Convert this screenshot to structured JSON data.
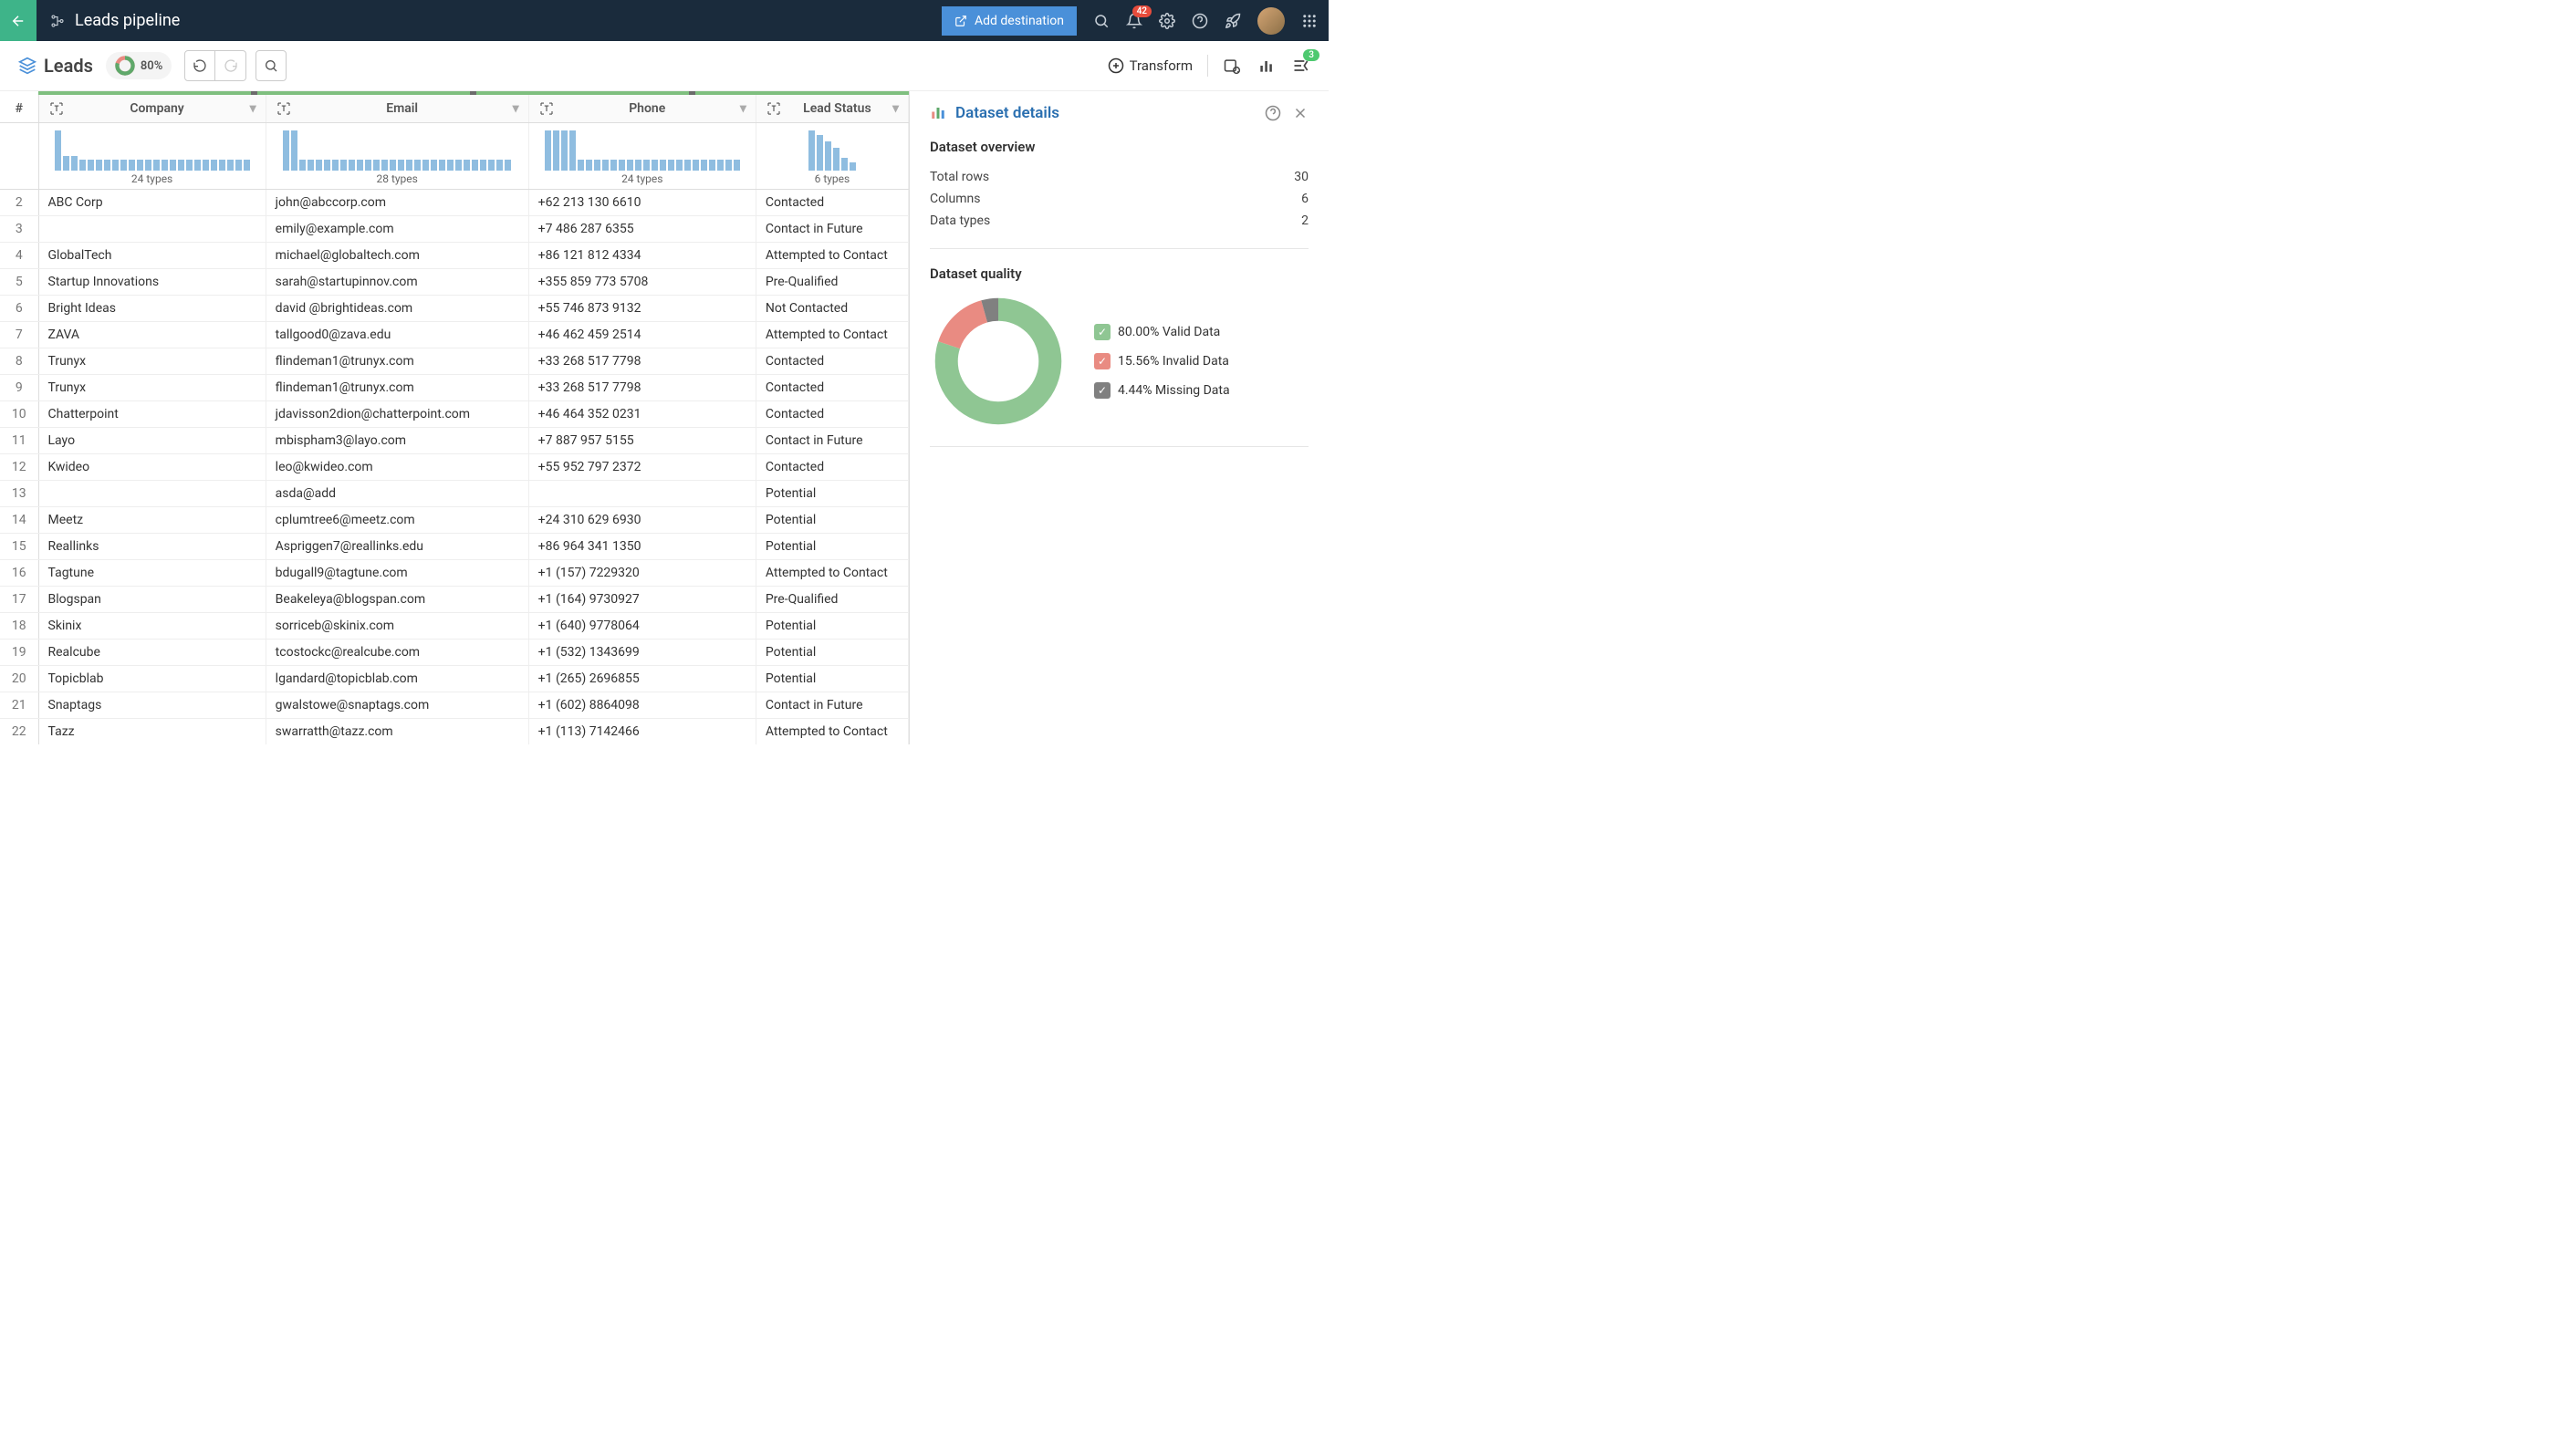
{
  "header": {
    "title": "Leads pipeline",
    "add_destination": "Add destination",
    "notifications_count": "42"
  },
  "toolbar": {
    "leads_label": "Leads",
    "quality_pct": "80%",
    "transform": "Transform",
    "steps_count": "3"
  },
  "columns": [
    {
      "name": "Company",
      "types": "24 types",
      "hist": [
        50,
        18,
        18,
        14,
        14,
        14,
        14,
        14,
        14,
        14,
        14,
        14,
        14,
        14,
        14,
        14,
        14,
        14,
        14,
        14,
        14,
        14,
        14,
        14
      ]
    },
    {
      "name": "Email",
      "types": "28 types",
      "hist": [
        50,
        50,
        14,
        14,
        14,
        14,
        14,
        14,
        14,
        14,
        14,
        14,
        14,
        14,
        14,
        14,
        14,
        14,
        14,
        14,
        14,
        14,
        14,
        14,
        14,
        14,
        14,
        14
      ]
    },
    {
      "name": "Phone",
      "types": "24 types",
      "hist": [
        50,
        50,
        50,
        50,
        14,
        14,
        14,
        14,
        14,
        14,
        14,
        14,
        14,
        14,
        14,
        14,
        14,
        14,
        14,
        14,
        14,
        14,
        14,
        14
      ]
    },
    {
      "name": "Lead Status",
      "types": "6 types",
      "hist": [
        50,
        44,
        36,
        28,
        16,
        10
      ]
    }
  ],
  "rows": [
    {
      "n": 2,
      "company": "ABC Corp",
      "email": "john@abccorp.com",
      "phone": "+62 213 130 6610",
      "status": "Contacted"
    },
    {
      "n": 3,
      "company": "",
      "email": "emily@example.com",
      "phone": "+7 486 287 6355",
      "status": "Contact in Future"
    },
    {
      "n": 4,
      "company": "GlobalTech",
      "email": "michael@globaltech.com",
      "phone": "+86 121 812 4334",
      "status": "Attempted to Contact"
    },
    {
      "n": 5,
      "company": "Startup Innovations",
      "email": "sarah@startupinnov.com",
      "phone": "+355 859 773 5708",
      "status": "Pre-Qualified"
    },
    {
      "n": 6,
      "company": "Bright Ideas",
      "email": "david  @brightideas.com",
      "phone": "+55 746 873 9132",
      "status": "Not Contacted"
    },
    {
      "n": 7,
      "company": "ZAVA",
      "email": "tallgood0@zava.edu",
      "phone": "+46 462 459 2514",
      "status": "Attempted to Contact"
    },
    {
      "n": 8,
      "company": "Trunyx",
      "email": "flindeman1@trunyx.com",
      "phone": "+33 268 517 7798",
      "status": "Contacted"
    },
    {
      "n": 9,
      "company": "Trunyx",
      "email": "flindeman1@trunyx.com",
      "phone": "+33 268 517 7798",
      "status": "Contacted"
    },
    {
      "n": 10,
      "company": "Chatterpoint",
      "email": "jdavisson2dion@chatterpoint.com",
      "phone": "+46 464 352 0231",
      "status": "Contacted"
    },
    {
      "n": 11,
      "company": "Layo",
      "email": "mbispham3@layo.com",
      "phone": "+7 887 957 5155",
      "status": "Contact in Future"
    },
    {
      "n": 12,
      "company": "Kwideo",
      "email": "leo@kwideo.com",
      "phone": "+55 952 797 2372",
      "status": "Contacted"
    },
    {
      "n": 13,
      "company": "",
      "email": "asda@add",
      "phone": "",
      "status": "Potential"
    },
    {
      "n": 14,
      "company": "Meetz",
      "email": "cplumtree6@meetz.com",
      "phone": "+24 310 629 6930",
      "status": "Potential"
    },
    {
      "n": 15,
      "company": "Reallinks",
      "email": "Aspriggen7@reallinks.edu",
      "phone": "+86 964 341 1350",
      "status": "Potential"
    },
    {
      "n": 16,
      "company": "Tagtune",
      "email": "bdugall9@tagtune.com",
      "phone": "+1 (157) 7229320",
      "status": "Attempted to Contact"
    },
    {
      "n": 17,
      "company": "Blogspan",
      "email": "Beakeleya@blogspan.com",
      "phone": "+1 (164) 9730927",
      "status": "Pre-Qualified"
    },
    {
      "n": 18,
      "company": "Skinix",
      "email": "sorriceb@skinix.com",
      "phone": "+1 (640) 9778064",
      "status": "Potential"
    },
    {
      "n": 19,
      "company": "Realcube",
      "email": "tcostockc@realcube.com",
      "phone": "+1 (532) 1343699",
      "status": "Potential"
    },
    {
      "n": 20,
      "company": "Topicblab",
      "email": "lgandard@topicblab.com",
      "phone": "+1 (265) 2696855",
      "status": "Potential"
    },
    {
      "n": 21,
      "company": "Snaptags",
      "email": "gwalstowe@snaptags.com",
      "phone": "+1 (602) 8864098",
      "status": "Contact in Future"
    },
    {
      "n": 22,
      "company": "Tazz",
      "email": "swarratth@tazz.com",
      "phone": "+1 (113) 7142466",
      "status": "Attempted to Contact"
    }
  ],
  "panel": {
    "title": "Dataset details",
    "overview_title": "Dataset overview",
    "total_rows_label": "Total rows",
    "total_rows": "30",
    "columns_label": "Columns",
    "columns": "6",
    "datatypes_label": "Data types",
    "datatypes": "2",
    "quality_title": "Dataset quality",
    "legend": {
      "valid": "80.00% Valid Data",
      "invalid": "15.56% Invalid Data",
      "missing": "4.44% Missing Data"
    }
  },
  "chart_data": {
    "type": "pie",
    "title": "Dataset quality",
    "series": [
      {
        "name": "Valid Data",
        "value": 80.0,
        "color": "#8fc693"
      },
      {
        "name": "Invalid Data",
        "value": 15.56,
        "color": "#e98b82"
      },
      {
        "name": "Missing Data",
        "value": 4.44,
        "color": "#808080"
      }
    ]
  }
}
